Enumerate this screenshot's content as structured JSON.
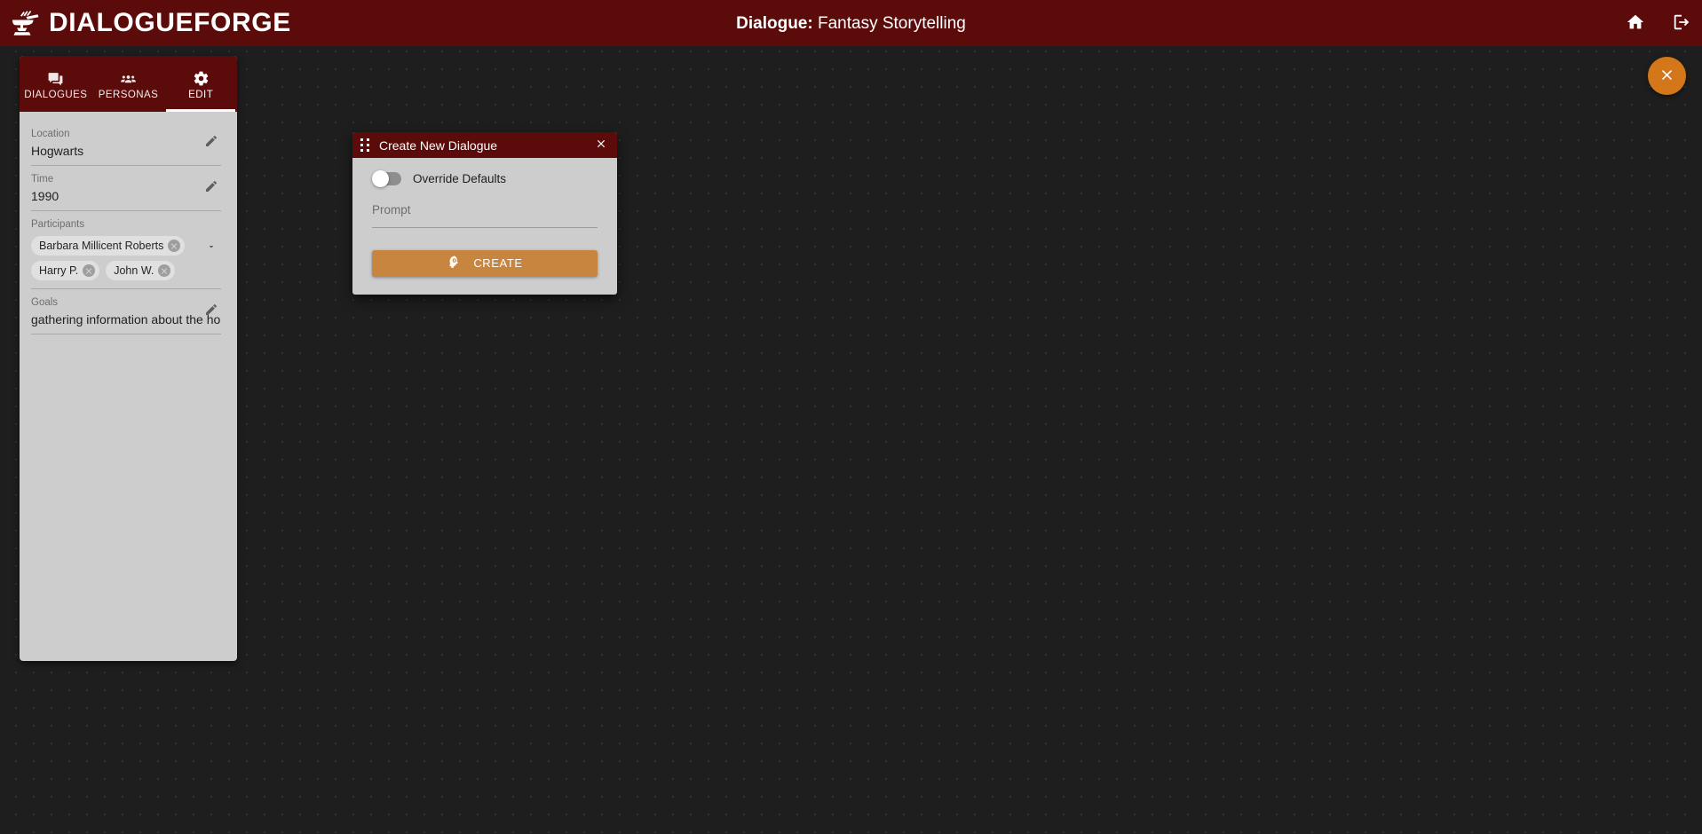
{
  "app": {
    "brand_name": "DIALOGUEFORGE",
    "brand_icon": "anvil-hammer-icon"
  },
  "header": {
    "title_prefix": "Dialogue:",
    "title_value": "Fantasy Storytelling",
    "home_icon": "home-icon",
    "logout_icon": "logout-icon"
  },
  "sidebar": {
    "tabs": [
      {
        "label": "DIALOGUES",
        "icon": "chat-bubbles-icon",
        "active": false
      },
      {
        "label": "PERSONAS",
        "icon": "people-group-icon",
        "active": false
      },
      {
        "label": "EDIT",
        "icon": "gear-icon",
        "active": true
      }
    ],
    "fields": {
      "location": {
        "label": "Location",
        "value": "Hogwarts",
        "action_icon": "pencil-icon"
      },
      "time": {
        "label": "Time",
        "value": "1990",
        "action_icon": "pencil-icon"
      },
      "participants": {
        "label": "Participants",
        "action_icon": "chevron-down-icon",
        "chips": [
          {
            "label": "Barbara Millicent Roberts",
            "remove_icon": "close-circle-icon"
          },
          {
            "label": "Harry P.",
            "remove_icon": "close-circle-icon"
          },
          {
            "label": "John W.",
            "remove_icon": "close-circle-icon"
          }
        ]
      },
      "goals": {
        "label": "Goals",
        "value": "gathering information about the horcr",
        "action_icon": "pencil-icon"
      }
    }
  },
  "modal": {
    "title": "Create New Dialogue",
    "drag_handle_icon": "drag-dots-icon",
    "close_icon": "close-icon",
    "override_toggle": {
      "label": "Override Defaults",
      "state": "off"
    },
    "prompt": {
      "placeholder": "Prompt",
      "value": ""
    },
    "create_button": {
      "label": "CREATE",
      "icon": "psychology-head-icon"
    }
  },
  "fab": {
    "close_label": "",
    "icon": "close-icon"
  },
  "colors": {
    "brand_maroon": "#5c0b0b",
    "accent_orange": "#d4761a",
    "button_tan": "#c8853f",
    "panel_gray": "#cdcdcd",
    "canvas_dark": "#1e1e1e"
  }
}
